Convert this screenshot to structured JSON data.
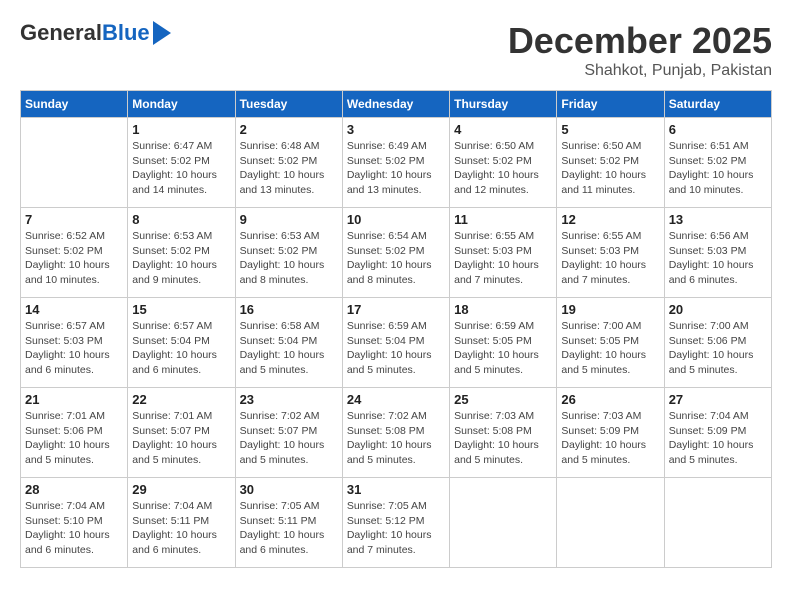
{
  "header": {
    "logo_general": "General",
    "logo_blue": "Blue",
    "month_title": "December 2025",
    "location": "Shahkot, Punjab, Pakistan"
  },
  "calendar": {
    "days_of_week": [
      "Sunday",
      "Monday",
      "Tuesday",
      "Wednesday",
      "Thursday",
      "Friday",
      "Saturday"
    ],
    "weeks": [
      [
        {
          "day": "",
          "info": ""
        },
        {
          "day": "1",
          "info": "Sunrise: 6:47 AM\nSunset: 5:02 PM\nDaylight: 10 hours\nand 14 minutes."
        },
        {
          "day": "2",
          "info": "Sunrise: 6:48 AM\nSunset: 5:02 PM\nDaylight: 10 hours\nand 13 minutes."
        },
        {
          "day": "3",
          "info": "Sunrise: 6:49 AM\nSunset: 5:02 PM\nDaylight: 10 hours\nand 13 minutes."
        },
        {
          "day": "4",
          "info": "Sunrise: 6:50 AM\nSunset: 5:02 PM\nDaylight: 10 hours\nand 12 minutes."
        },
        {
          "day": "5",
          "info": "Sunrise: 6:50 AM\nSunset: 5:02 PM\nDaylight: 10 hours\nand 11 minutes."
        },
        {
          "day": "6",
          "info": "Sunrise: 6:51 AM\nSunset: 5:02 PM\nDaylight: 10 hours\nand 10 minutes."
        }
      ],
      [
        {
          "day": "7",
          "info": "Sunrise: 6:52 AM\nSunset: 5:02 PM\nDaylight: 10 hours\nand 10 minutes."
        },
        {
          "day": "8",
          "info": "Sunrise: 6:53 AM\nSunset: 5:02 PM\nDaylight: 10 hours\nand 9 minutes."
        },
        {
          "day": "9",
          "info": "Sunrise: 6:53 AM\nSunset: 5:02 PM\nDaylight: 10 hours\nand 8 minutes."
        },
        {
          "day": "10",
          "info": "Sunrise: 6:54 AM\nSunset: 5:02 PM\nDaylight: 10 hours\nand 8 minutes."
        },
        {
          "day": "11",
          "info": "Sunrise: 6:55 AM\nSunset: 5:03 PM\nDaylight: 10 hours\nand 7 minutes."
        },
        {
          "day": "12",
          "info": "Sunrise: 6:55 AM\nSunset: 5:03 PM\nDaylight: 10 hours\nand 7 minutes."
        },
        {
          "day": "13",
          "info": "Sunrise: 6:56 AM\nSunset: 5:03 PM\nDaylight: 10 hours\nand 6 minutes."
        }
      ],
      [
        {
          "day": "14",
          "info": "Sunrise: 6:57 AM\nSunset: 5:03 PM\nDaylight: 10 hours\nand 6 minutes."
        },
        {
          "day": "15",
          "info": "Sunrise: 6:57 AM\nSunset: 5:04 PM\nDaylight: 10 hours\nand 6 minutes."
        },
        {
          "day": "16",
          "info": "Sunrise: 6:58 AM\nSunset: 5:04 PM\nDaylight: 10 hours\nand 5 minutes."
        },
        {
          "day": "17",
          "info": "Sunrise: 6:59 AM\nSunset: 5:04 PM\nDaylight: 10 hours\nand 5 minutes."
        },
        {
          "day": "18",
          "info": "Sunrise: 6:59 AM\nSunset: 5:05 PM\nDaylight: 10 hours\nand 5 minutes."
        },
        {
          "day": "19",
          "info": "Sunrise: 7:00 AM\nSunset: 5:05 PM\nDaylight: 10 hours\nand 5 minutes."
        },
        {
          "day": "20",
          "info": "Sunrise: 7:00 AM\nSunset: 5:06 PM\nDaylight: 10 hours\nand 5 minutes."
        }
      ],
      [
        {
          "day": "21",
          "info": "Sunrise: 7:01 AM\nSunset: 5:06 PM\nDaylight: 10 hours\nand 5 minutes."
        },
        {
          "day": "22",
          "info": "Sunrise: 7:01 AM\nSunset: 5:07 PM\nDaylight: 10 hours\nand 5 minutes."
        },
        {
          "day": "23",
          "info": "Sunrise: 7:02 AM\nSunset: 5:07 PM\nDaylight: 10 hours\nand 5 minutes."
        },
        {
          "day": "24",
          "info": "Sunrise: 7:02 AM\nSunset: 5:08 PM\nDaylight: 10 hours\nand 5 minutes."
        },
        {
          "day": "25",
          "info": "Sunrise: 7:03 AM\nSunset: 5:08 PM\nDaylight: 10 hours\nand 5 minutes."
        },
        {
          "day": "26",
          "info": "Sunrise: 7:03 AM\nSunset: 5:09 PM\nDaylight: 10 hours\nand 5 minutes."
        },
        {
          "day": "27",
          "info": "Sunrise: 7:04 AM\nSunset: 5:09 PM\nDaylight: 10 hours\nand 5 minutes."
        }
      ],
      [
        {
          "day": "28",
          "info": "Sunrise: 7:04 AM\nSunset: 5:10 PM\nDaylight: 10 hours\nand 6 minutes."
        },
        {
          "day": "29",
          "info": "Sunrise: 7:04 AM\nSunset: 5:11 PM\nDaylight: 10 hours\nand 6 minutes."
        },
        {
          "day": "30",
          "info": "Sunrise: 7:05 AM\nSunset: 5:11 PM\nDaylight: 10 hours\nand 6 minutes."
        },
        {
          "day": "31",
          "info": "Sunrise: 7:05 AM\nSunset: 5:12 PM\nDaylight: 10 hours\nand 7 minutes."
        },
        {
          "day": "",
          "info": ""
        },
        {
          "day": "",
          "info": ""
        },
        {
          "day": "",
          "info": ""
        }
      ]
    ]
  }
}
